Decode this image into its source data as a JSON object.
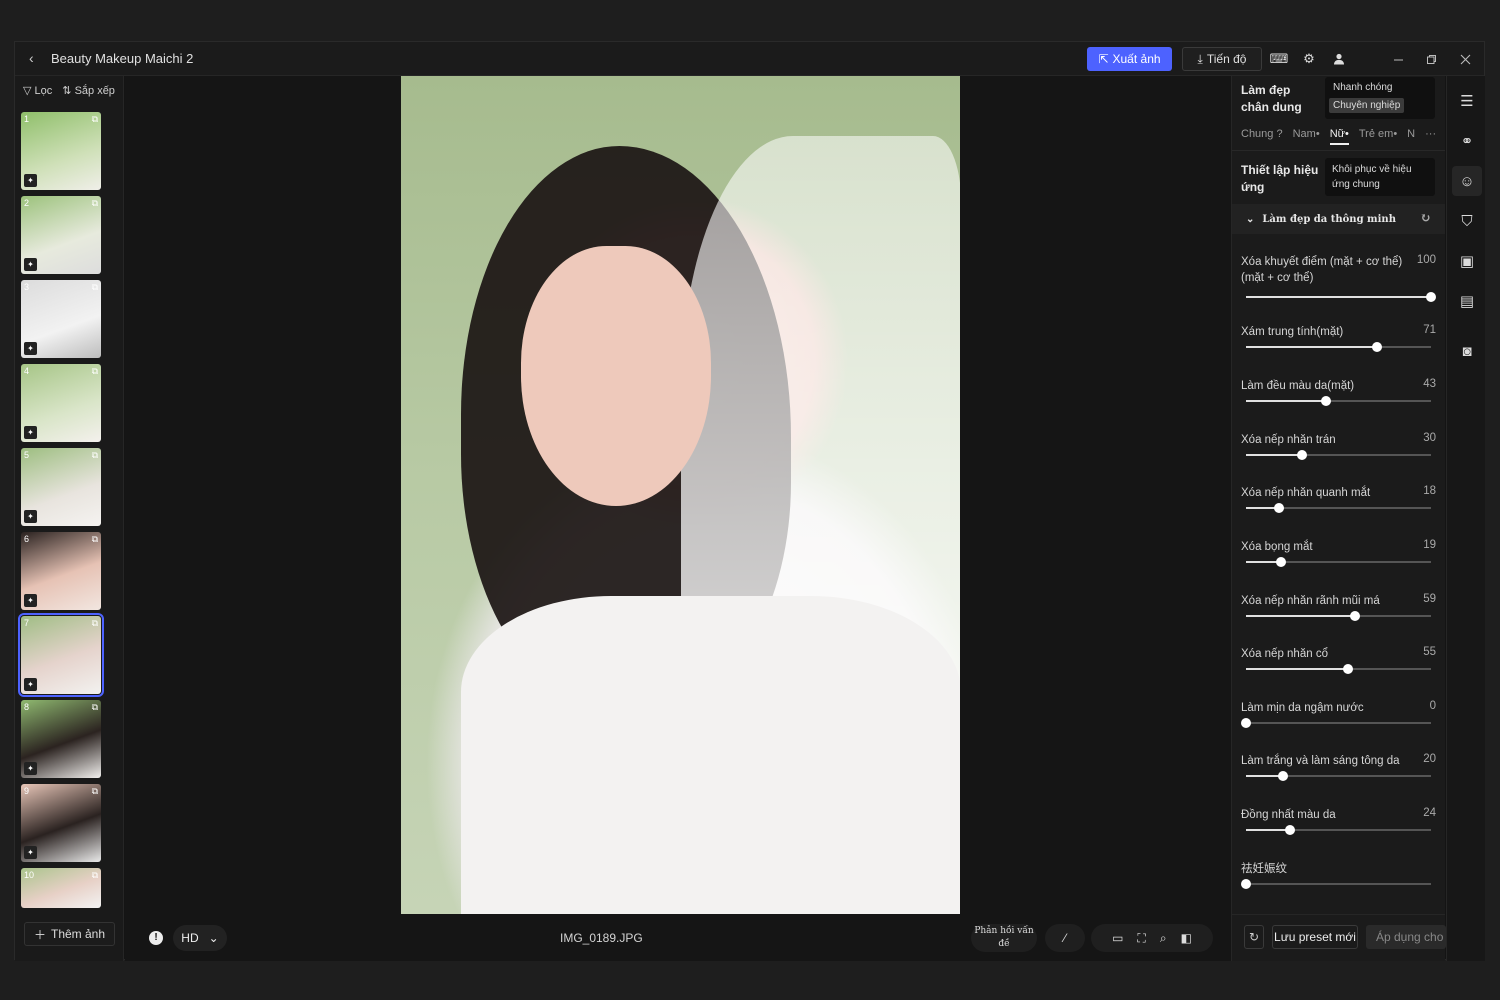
{
  "titlebar": {
    "back_glyph": "‹",
    "project_name": "Beauty Makeup Maichi 2",
    "export_label": "Xuất ảnh",
    "progress_label": "Tiến độ"
  },
  "filmstrip": {
    "filter_label": "Lọc",
    "sort_label": "Sắp xếp",
    "thumbs": [
      "1",
      "2",
      "3",
      "4",
      "5",
      "6",
      "7",
      "8",
      "9",
      "10"
    ],
    "selected": "7",
    "add_label": "Thêm ảnh"
  },
  "canvas": {
    "quality": "HD",
    "filename": "IMG_0189.JPG",
    "feedback_label": "Phản hồi vấn đề"
  },
  "panel": {
    "mode_title": "Làm đẹp chân dung",
    "mode_options": [
      "Nhanh chóng",
      "Chuyên nghiệp"
    ],
    "mode_selected": "Chuyên nghiệp",
    "tabs": [
      "Chung",
      "Nam",
      "Nữ",
      "Trẻ em",
      "N"
    ],
    "tab_selected": "Nữ",
    "more_glyph": "···",
    "settings_title": "Thiết lập hiệu ứng",
    "restore_label": "Khôi phục về hiệu ứng chung",
    "section_title": "Làm đẹp da thông minh",
    "sliders": [
      {
        "label": "Xóa khuyết điểm (mặt + cơ thể) (mặt + cơ thể)",
        "value": 100
      },
      {
        "label": "Xám trung tính(mặt)",
        "value": 71
      },
      {
        "label": "Làm đều màu da(mặt)",
        "value": 43
      },
      {
        "label": "Xóa nếp nhăn trán",
        "value": 30
      },
      {
        "label": "Xóa nếp nhăn quanh mắt",
        "value": 18
      },
      {
        "label": "Xóa bọng mắt",
        "value": 19
      },
      {
        "label": "Xóa nếp nhăn rãnh mũi má",
        "value": 59
      },
      {
        "label": "Xóa nếp nhăn cổ",
        "value": 55
      },
      {
        "label": "Làm mịn da ngậm nước",
        "value": 0
      },
      {
        "label": "Làm trắng và làm sáng tông da",
        "value": 20
      },
      {
        "label": "Đồng nhất màu da",
        "value": 24
      },
      {
        "label": "祛妊娠纹",
        "value": ""
      }
    ],
    "save_preset_label": "Lưu preset mới",
    "apply_label": "Áp dụng cho"
  },
  "colors": {
    "accent": "#4d62ff",
    "background": "#141414",
    "panel": "#1b1b1b"
  }
}
